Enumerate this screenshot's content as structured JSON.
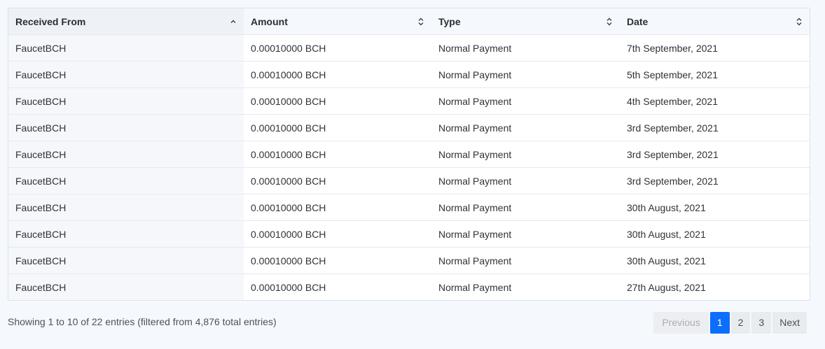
{
  "table": {
    "columns": [
      {
        "label": "Received From",
        "sort": "asc"
      },
      {
        "label": "Amount",
        "sort": "none"
      },
      {
        "label": "Type",
        "sort": "none"
      },
      {
        "label": "Date",
        "sort": "none"
      }
    ],
    "rows": [
      {
        "from": "FaucetBCH",
        "amount": "0.00010000 BCH",
        "type": "Normal Payment",
        "date": "7th September, 2021"
      },
      {
        "from": "FaucetBCH",
        "amount": "0.00010000 BCH",
        "type": "Normal Payment",
        "date": "5th September, 2021"
      },
      {
        "from": "FaucetBCH",
        "amount": "0.00010000 BCH",
        "type": "Normal Payment",
        "date": "4th September, 2021"
      },
      {
        "from": "FaucetBCH",
        "amount": "0.00010000 BCH",
        "type": "Normal Payment",
        "date": "3rd September, 2021"
      },
      {
        "from": "FaucetBCH",
        "amount": "0.00010000 BCH",
        "type": "Normal Payment",
        "date": "3rd September, 2021"
      },
      {
        "from": "FaucetBCH",
        "amount": "0.00010000 BCH",
        "type": "Normal Payment",
        "date": "3rd September, 2021"
      },
      {
        "from": "FaucetBCH",
        "amount": "0.00010000 BCH",
        "type": "Normal Payment",
        "date": "30th August, 2021"
      },
      {
        "from": "FaucetBCH",
        "amount": "0.00010000 BCH",
        "type": "Normal Payment",
        "date": "30th August, 2021"
      },
      {
        "from": "FaucetBCH",
        "amount": "0.00010000 BCH",
        "type": "Normal Payment",
        "date": "30th August, 2021"
      },
      {
        "from": "FaucetBCH",
        "amount": "0.00010000 BCH",
        "type": "Normal Payment",
        "date": "27th August, 2021"
      }
    ]
  },
  "footer": {
    "info": "Showing 1 to 10 of 22 entries (filtered from 4,876 total entries)"
  },
  "pagination": {
    "previous_label": "Previous",
    "next_label": "Next",
    "pages": [
      "1",
      "2",
      "3"
    ],
    "current": "1"
  },
  "colors": {
    "accent": "#0d6efd",
    "header_bg": "#f5f8fc",
    "sorted_column_bg": "#f5f7fa"
  }
}
